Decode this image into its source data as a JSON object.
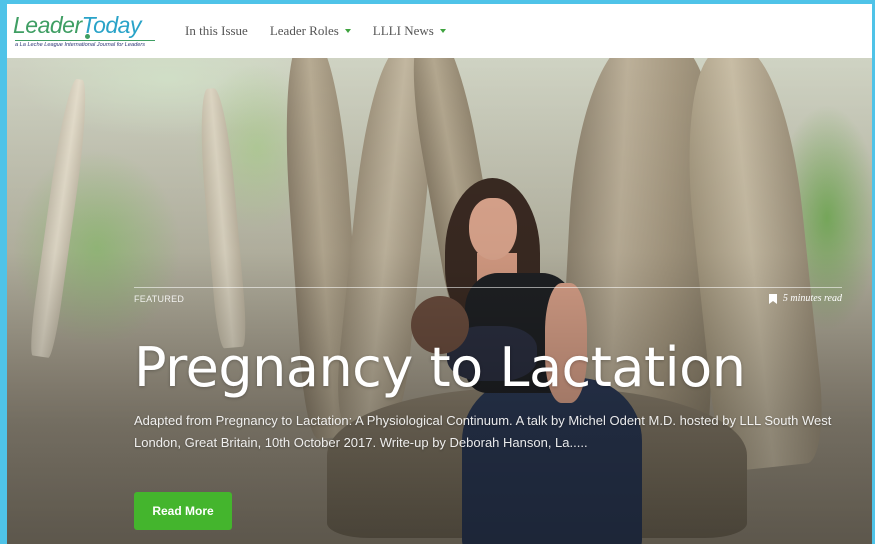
{
  "header": {
    "logo": {
      "brand_part1": "Leader",
      "brand_part2": "Today",
      "tagline": "a La Leche League International Journal for Leaders"
    },
    "nav": [
      {
        "label": "In this Issue",
        "has_dropdown": false
      },
      {
        "label": "Leader Roles",
        "has_dropdown": true
      },
      {
        "label": "LLLI News",
        "has_dropdown": true
      }
    ]
  },
  "hero": {
    "category": "FEATURED",
    "read_time": "5 minutes read",
    "title": "Pregnancy to Lactation",
    "excerpt": "Adapted from Pregnancy to Lactation: A Physiological Continuum. A talk by Michel Odent M.D. hosted by LLL South West London, Great Britain, 10th October 2017. Write-up by Deborah Hanson, La.....",
    "button_label": "Read More"
  },
  "colors": {
    "accent_green": "#44b52d",
    "frame_blue": "#4fc3e8",
    "logo_green": "#3f9e63",
    "logo_blue": "#2aa3c8"
  },
  "icons": {
    "dropdown": "chevron-down-icon",
    "bookmark": "bookmark-icon"
  }
}
